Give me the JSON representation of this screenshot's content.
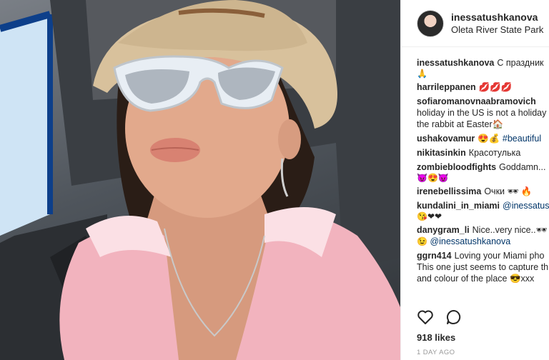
{
  "header": {
    "username": "inessatushkanova",
    "location": "Oleta River State Park"
  },
  "comments": [
    {
      "user": "inessatushkanova",
      "lines": [
        "С праздник"
      ],
      "emoji_line": "🙏"
    },
    {
      "user": "harrileppanen",
      "lines": [
        "💋💋💋"
      ]
    },
    {
      "user": "sofiaromanovnaabramovich",
      "lines": [
        "",
        "holiday in the US is not a holiday",
        "the rabbit at Easter🏠"
      ]
    },
    {
      "user": "ushakovamur",
      "lines": [
        "😍💰"
      ],
      "mention": "#beautiful"
    },
    {
      "user": "nikitasinkin",
      "lines": [
        "Красотулька"
      ]
    },
    {
      "user": "zombiebloodfights",
      "lines": [
        "Goddamn..."
      ],
      "emoji_line": "😈😍😈"
    },
    {
      "user": "irenebellissima",
      "lines": [
        "Очки 🕶 🔥"
      ]
    },
    {
      "user": "kundalini_in_miami",
      "lines": [
        ""
      ],
      "mention": "@inessatusi",
      "emoji_line": "😘❤❤"
    },
    {
      "user": "danygram_li",
      "lines": [
        "Nice..very nice..🕶"
      ],
      "emoji_line": "😉",
      "mention2": "@inessatushkanova"
    },
    {
      "user": "ggrn414",
      "lines": [
        "Loving your Miami pho",
        "This one just seems to capture th",
        "and colour of the place 😎xxx"
      ]
    }
  ],
  "actions": {
    "like_icon": "heart-icon",
    "comment_icon": "comment-icon"
  },
  "likes": "918 likes",
  "posted": "1 DAY AGO"
}
